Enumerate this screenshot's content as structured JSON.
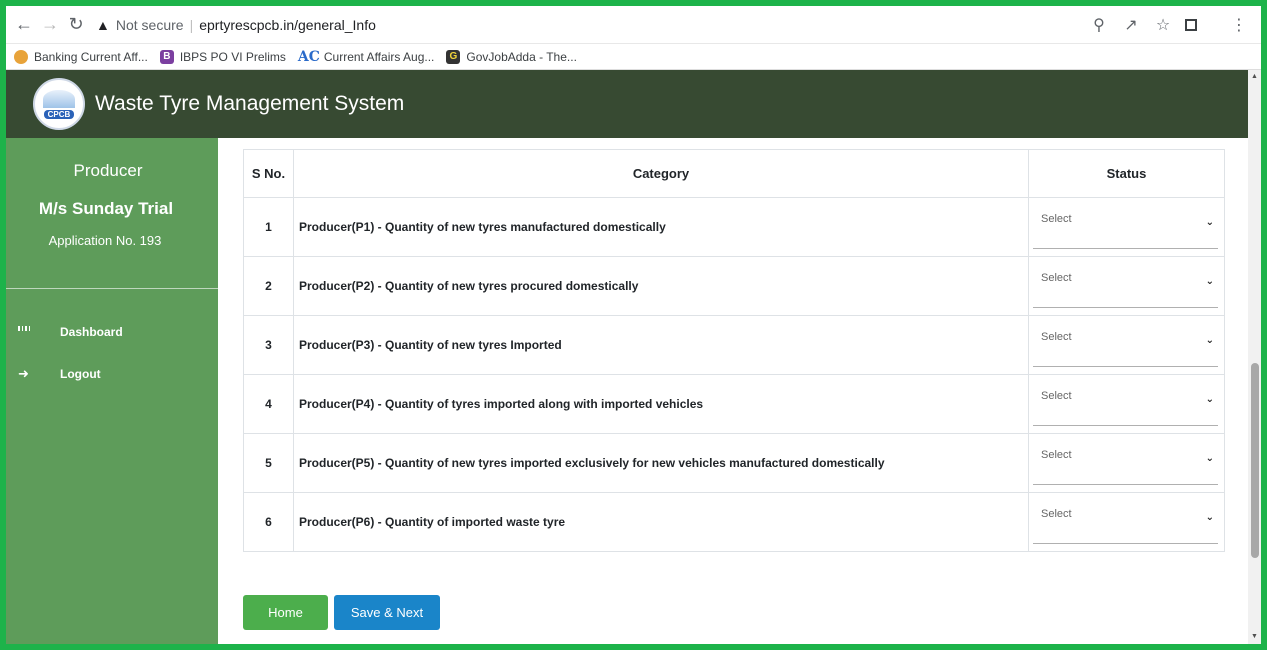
{
  "browser": {
    "not_secure": "Not secure",
    "url": "eprtyrescpcb.in/general_Info",
    "bookmarks": [
      {
        "label": "Banking Current Aff...",
        "icon": "medal-icon"
      },
      {
        "label": "IBPS PO VI Prelims",
        "icon": "ibps-icon"
      },
      {
        "label": "Current Affairs Aug...",
        "icon": "ac-icon"
      },
      {
        "label": "GovJobAdda - The...",
        "icon": "govjobadda-icon"
      }
    ]
  },
  "header": {
    "logo_text": "CPCB",
    "title": "Waste Tyre Management System"
  },
  "sidebar": {
    "role": "Producer",
    "name": "M/s Sunday Trial",
    "application": "Application No. 193",
    "items": [
      {
        "label": "Dashboard",
        "icon": "dashboard-icon"
      },
      {
        "label": "Logout",
        "icon": "arrow-right-icon"
      }
    ]
  },
  "table": {
    "headers": {
      "sno": "S No.",
      "category": "Category",
      "status": "Status"
    },
    "rows": [
      {
        "sno": "1",
        "category": "Producer(P1) - Quantity of new tyres manufactured domestically",
        "status": "Select"
      },
      {
        "sno": "2",
        "category": "Producer(P2) - Quantity of new tyres procured domestically",
        "status": "Select"
      },
      {
        "sno": "3",
        "category": "Producer(P3) - Quantity of new tyres Imported",
        "status": "Select"
      },
      {
        "sno": "4",
        "category": "Producer(P4) - Quantity of tyres imported along with imported vehicles",
        "status": "Select"
      },
      {
        "sno": "5",
        "category": "Producer(P5) - Quantity of new tyres imported exclusively for new vehicles manufactured domestically",
        "status": "Select"
      },
      {
        "sno": "6",
        "category": "Producer(P6) - Quantity of imported waste tyre",
        "status": "Select"
      }
    ]
  },
  "buttons": {
    "home": "Home",
    "save_next": "Save & Next"
  },
  "colors": {
    "header_bg": "#374a32",
    "sidebar_bg": "#5e9c5a",
    "home_btn": "#4cae4c",
    "save_btn": "#1a85c9",
    "frame_border": "#1db34a"
  }
}
